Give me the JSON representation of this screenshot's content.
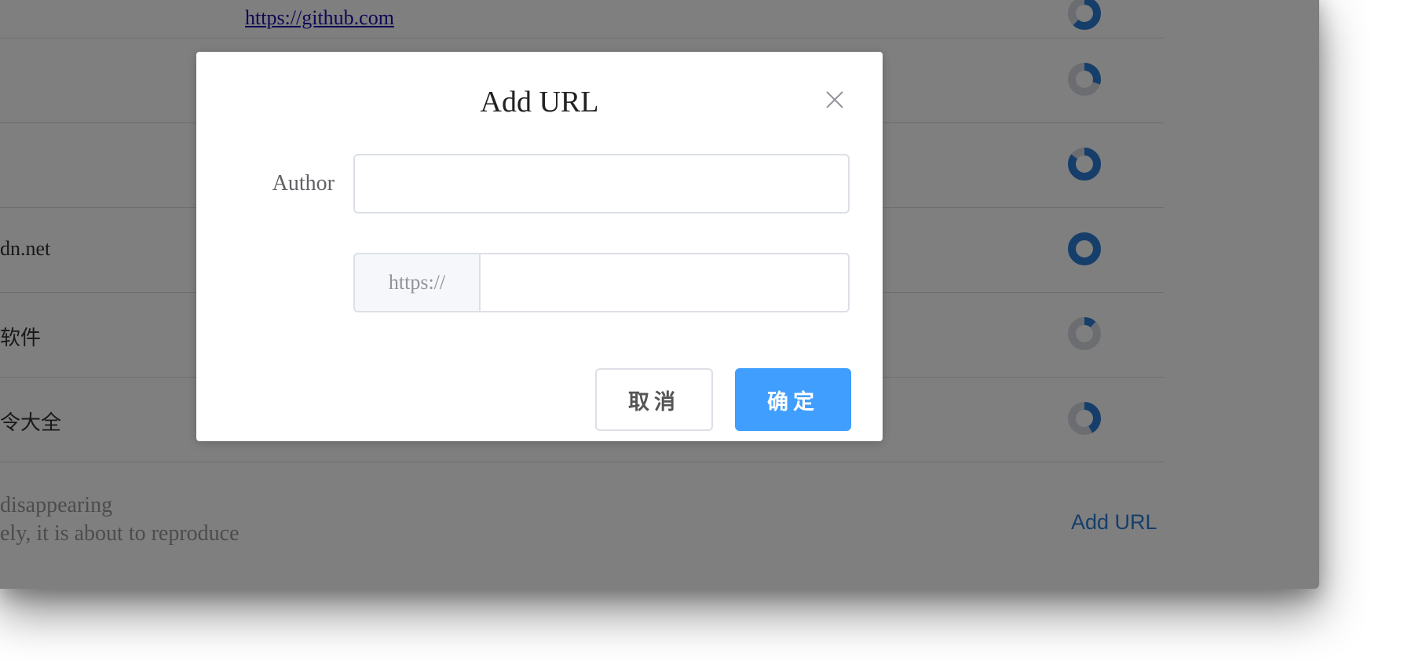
{
  "background_list": {
    "rows": [
      {
        "text": "",
        "link": "https://github.com",
        "donut_fill": 0.62
      },
      {
        "text": "",
        "link": "",
        "donut_fill": 0.3
      },
      {
        "text": "",
        "link": "",
        "donut_fill": 0.85
      },
      {
        "text": "dn.net",
        "link": "",
        "donut_fill": 1.0
      },
      {
        "text": "软件",
        "link": "",
        "donut_fill": 0.12
      },
      {
        "text": "令大全",
        "link": "",
        "donut_fill": 0.42
      }
    ],
    "footer_line1": "disappearing",
    "footer_line2": "ely, it is about to reproduce",
    "add_url_label": "Add URL"
  },
  "colors": {
    "donut_fill": "#2a7dd6",
    "donut_track": "#d6dbe3",
    "primary": "#409eff",
    "link": "#1a0dab"
  },
  "dialog": {
    "title": "Add URL",
    "close_icon": "close-icon",
    "author_label": "Author",
    "author_value": "",
    "author_placeholder": "",
    "url_prefix": "https://",
    "url_value": "",
    "url_placeholder": "",
    "cancel_label": "取消",
    "confirm_label": "确定"
  }
}
